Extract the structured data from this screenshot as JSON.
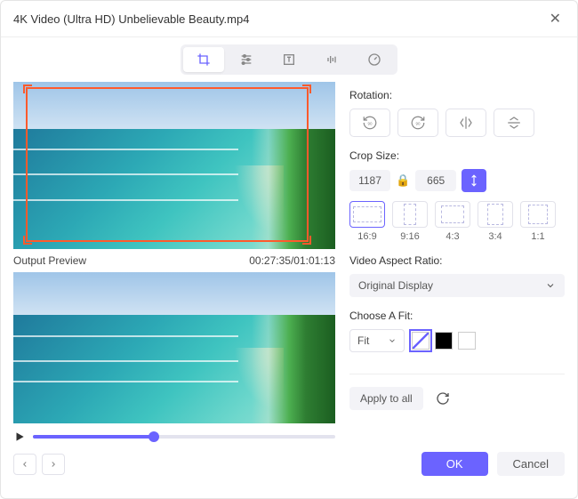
{
  "titlebar": {
    "title": "4K Video (Ultra HD) Unbelievable Beauty.mp4"
  },
  "tabs": {
    "active": "crop"
  },
  "preview": {
    "output_label": "Output Preview",
    "timecode": "00:27:35/01:01:13",
    "play_progress_pct": 40
  },
  "rotation": {
    "label": "Rotation:"
  },
  "crop_size": {
    "label": "Crop Size:",
    "width": "1187",
    "height": "665"
  },
  "ratios": [
    {
      "label": "16:9",
      "w": 32,
      "h": 18,
      "active": true
    },
    {
      "label": "9:16",
      "w": 14,
      "h": 24,
      "active": false
    },
    {
      "label": "4:3",
      "w": 26,
      "h": 20,
      "active": false
    },
    {
      "label": "3:4",
      "w": 18,
      "h": 24,
      "active": false
    },
    {
      "label": "1:1",
      "w": 22,
      "h": 22,
      "active": false
    }
  ],
  "aspect": {
    "label": "Video Aspect Ratio:",
    "value": "Original Display"
  },
  "fit": {
    "label": "Choose A Fit:",
    "value": "Fit",
    "swatches": [
      "#ffffff",
      "#000000",
      "#ffffff"
    ],
    "active_swatch": 0
  },
  "apply": {
    "label": "Apply to all"
  },
  "footer": {
    "ok": "OK",
    "cancel": "Cancel"
  }
}
